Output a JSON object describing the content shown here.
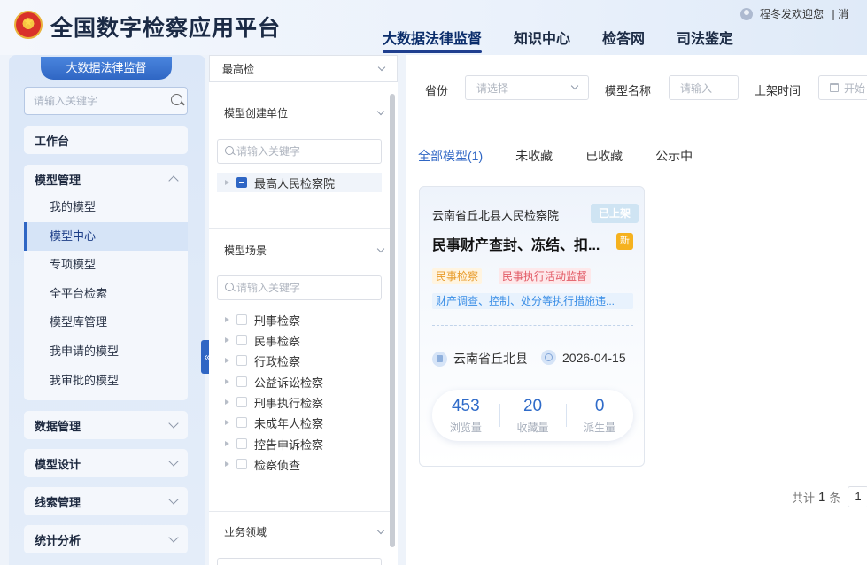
{
  "header": {
    "app_title": "全国数字检察应用平台",
    "nav": [
      "大数据法律监督",
      "知识中心",
      "检答网",
      "司法鉴定"
    ],
    "active_nav": 0,
    "user_name": "程冬发",
    "welcome": "欢迎您",
    "logout": "❘消"
  },
  "sidebar": {
    "title": "大数据法律监督",
    "search_placeholder": "请输入关键字",
    "sections": [
      {
        "label": "工作台"
      },
      {
        "label": "模型管理",
        "expanded": true,
        "items": [
          "我的模型",
          "模型中心",
          "专项模型",
          "全平台检索",
          "模型库管理",
          "我申请的模型",
          "我审批的模型"
        ],
        "active_item": "模型中心"
      },
      {
        "label": "数据管理"
      },
      {
        "label": "模型设计"
      },
      {
        "label": "线索管理"
      },
      {
        "label": "统计分析"
      }
    ]
  },
  "filters": {
    "scope_value": "最高检",
    "unit_section": {
      "title": "模型创建单位",
      "search_placeholder": "请输入关键字",
      "tree": [
        "最高人民检察院"
      ]
    },
    "scene_section": {
      "title": "模型场景",
      "search_placeholder": "请输入关键字",
      "items": [
        "刑事检察",
        "民事检察",
        "行政检察",
        "公益诉讼检察",
        "刑事执行检察",
        "未成年人检察",
        "控告申诉检察",
        "检察侦查"
      ]
    },
    "domain_section": {
      "title": "业务领域"
    }
  },
  "main": {
    "filters": {
      "province_label": "省份",
      "province_placeholder": "请选择",
      "model_name_label": "模型名称",
      "model_name_placeholder": "请输入",
      "listed_time_label": "上架时间",
      "listed_time_placeholder": "开始"
    },
    "tabs": [
      "全部模型(1)",
      "未收藏",
      "已收藏",
      "公示中"
    ],
    "active_tab": 0,
    "card": {
      "org": "云南省丘北县人民检察院",
      "status": "已上架",
      "title": "民事财产查封、冻结、扣...",
      "new_badge": "新",
      "tags": [
        "民事检察",
        "民事执行活动监督"
      ],
      "scope_tag": "财产调查、控制、处分等执行措施违...",
      "location": "云南省丘北县",
      "date": "2026-04-15",
      "stats": [
        {
          "value": "453",
          "label": "浏览量"
        },
        {
          "value": "20",
          "label": "收藏量"
        },
        {
          "value": "0",
          "label": "派生量"
        }
      ]
    },
    "pager": {
      "prefix": "共计",
      "total": "1",
      "suffix": "条",
      "page": "1"
    }
  },
  "colors": {
    "accent": "#2f66c4",
    "active_tab": "#2f66c4",
    "status_badge": "#cfe4f3",
    "new_badge": "#f5b21f"
  }
}
